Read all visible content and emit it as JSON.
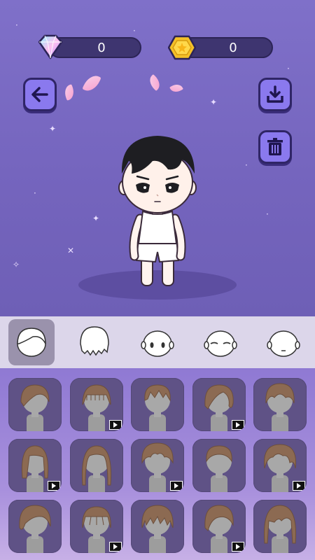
{
  "currency": {
    "gems": "0",
    "coins": "0"
  },
  "icons": {
    "gem": "diamond-gem-icon",
    "coin": "gold-coin-icon",
    "back": "back-arrow-icon",
    "download": "download-icon",
    "delete": "trash-icon"
  },
  "colors": {
    "stage_bg": "#7b6bc4",
    "button_bg": "#8a79ee",
    "item_bg": "#5f5286",
    "tab_bar_bg": "#dcd6ea",
    "tab_active_bg": "#9a92ac"
  },
  "category_tabs": [
    {
      "name": "hair-tab",
      "selected": true
    },
    {
      "name": "back-hair-tab",
      "selected": false
    },
    {
      "name": "eyes-tab",
      "selected": false
    },
    {
      "name": "eyebrows-tab",
      "selected": false
    },
    {
      "name": "mouth-tab",
      "selected": false
    }
  ],
  "hair_items": [
    {
      "style": "side-swept-short",
      "video_locked": false
    },
    {
      "style": "blunt-bangs-bob",
      "video_locked": true
    },
    {
      "style": "spiky-short",
      "video_locked": false
    },
    {
      "style": "wavy-side-part",
      "video_locked": true
    },
    {
      "style": "tousled-medium",
      "video_locked": false
    },
    {
      "style": "parted-shoulder",
      "video_locked": true
    },
    {
      "style": "long-straight",
      "video_locked": false
    },
    {
      "style": "curly-top",
      "video_locked": true
    },
    {
      "style": "neat-crop",
      "video_locked": false
    },
    {
      "style": "messy-waves",
      "video_locked": true
    },
    {
      "style": "side-fringe",
      "video_locked": false
    },
    {
      "style": "straight-fringe",
      "video_locked": true
    },
    {
      "style": "layered-shag",
      "video_locked": false
    },
    {
      "style": "swoop-fringe",
      "video_locked": true
    },
    {
      "style": "long-layers",
      "video_locked": false
    }
  ]
}
